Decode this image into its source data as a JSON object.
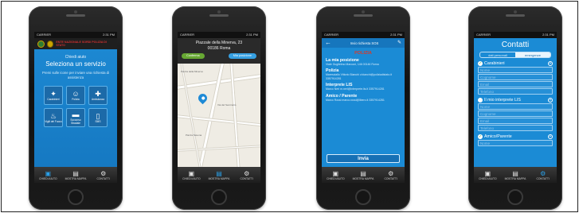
{
  "screens": {
    "s1": {
      "carrier": "CARRIER",
      "time": "2:31 PM",
      "logo_text": "ENTE NAZIONALE SORDI POLIZIA DI STATO",
      "heading_small": "Chiedi aiuto",
      "heading_big": "Seleziona un servizio",
      "subtitle": "Premi sulle icone per inviare una richiesta di assistenza",
      "services": [
        {
          "label": "Carabinieri",
          "icon": "shield-icon",
          "glyph": "✦"
        },
        {
          "label": "Polizia",
          "icon": "officer-icon",
          "glyph": "☺"
        },
        {
          "label": "Ambulanza",
          "icon": "ambulance-icon",
          "glyph": "✚"
        },
        {
          "label": "Vigili del Fuoco",
          "icon": "fire-icon",
          "glyph": "♨"
        },
        {
          "label": "Soccorso Stradale",
          "icon": "car-icon",
          "glyph": "▬"
        },
        {
          "label": "SMS",
          "icon": "phone-icon",
          "glyph": "▯"
        }
      ]
    },
    "s2": {
      "carrier": "CARRIER",
      "time": "2:31 PM",
      "address_line1": "Piazzale della Minerva, 23",
      "address_line2": "00186 Roma",
      "confirm": "Conferma",
      "my_position": "Mia posizione",
      "map_labels": [
        "Piazza della Minerva",
        "Via del Seminario",
        "Piazza Navona"
      ]
    },
    "s3": {
      "carrier": "CARRIER",
      "time": "2:31 PM",
      "nav_title": "Invio richiesta SOS",
      "service": "POLIZIA",
      "blocks": [
        {
          "title": "La mia posizione",
          "detail": "Viale Guglielmo Marconi, 146 00146 Roma"
        },
        {
          "title": "Polizia",
          "detail": "Maresciallo Vittorio Bianchi v.bianchi@poliziadistato.it 3357914281"
        },
        {
          "title": "Interprete LIS",
          "detail": "Marco Neri m.neri@interprete.lis.it 3357914281"
        },
        {
          "title": "Amico / Parente",
          "detail": "Marco Rossi marco.rossi@libero.it 3357914281"
        }
      ],
      "send": "Invia"
    },
    "s4": {
      "carrier": "CARRIER",
      "time": "2:31 PM",
      "title": "Contatti",
      "tab_personal": "dati personali",
      "tab_emergency": "emergenze",
      "sections": [
        {
          "label": "Carabinieri",
          "checked": true,
          "fields": [
            "Nome",
            "Cognome",
            "Email",
            "Telefono"
          ]
        },
        {
          "label": "Il mio interprete LIS",
          "checked": false,
          "fields": [
            "Nome",
            "Cognome",
            "Email",
            "Telefono"
          ]
        },
        {
          "label": "Amico/Parente",
          "checked": true,
          "fields": [
            "Nome"
          ]
        }
      ]
    }
  },
  "tabbar": {
    "items": [
      {
        "label": "Chiedi aiuto",
        "icon": "briefcase-icon",
        "glyph": "▣"
      },
      {
        "label": "Mostra mappa",
        "icon": "map-icon",
        "glyph": "▤"
      },
      {
        "label": "Contatti",
        "icon": "gear-icon",
        "glyph": "⚙"
      }
    ]
  }
}
